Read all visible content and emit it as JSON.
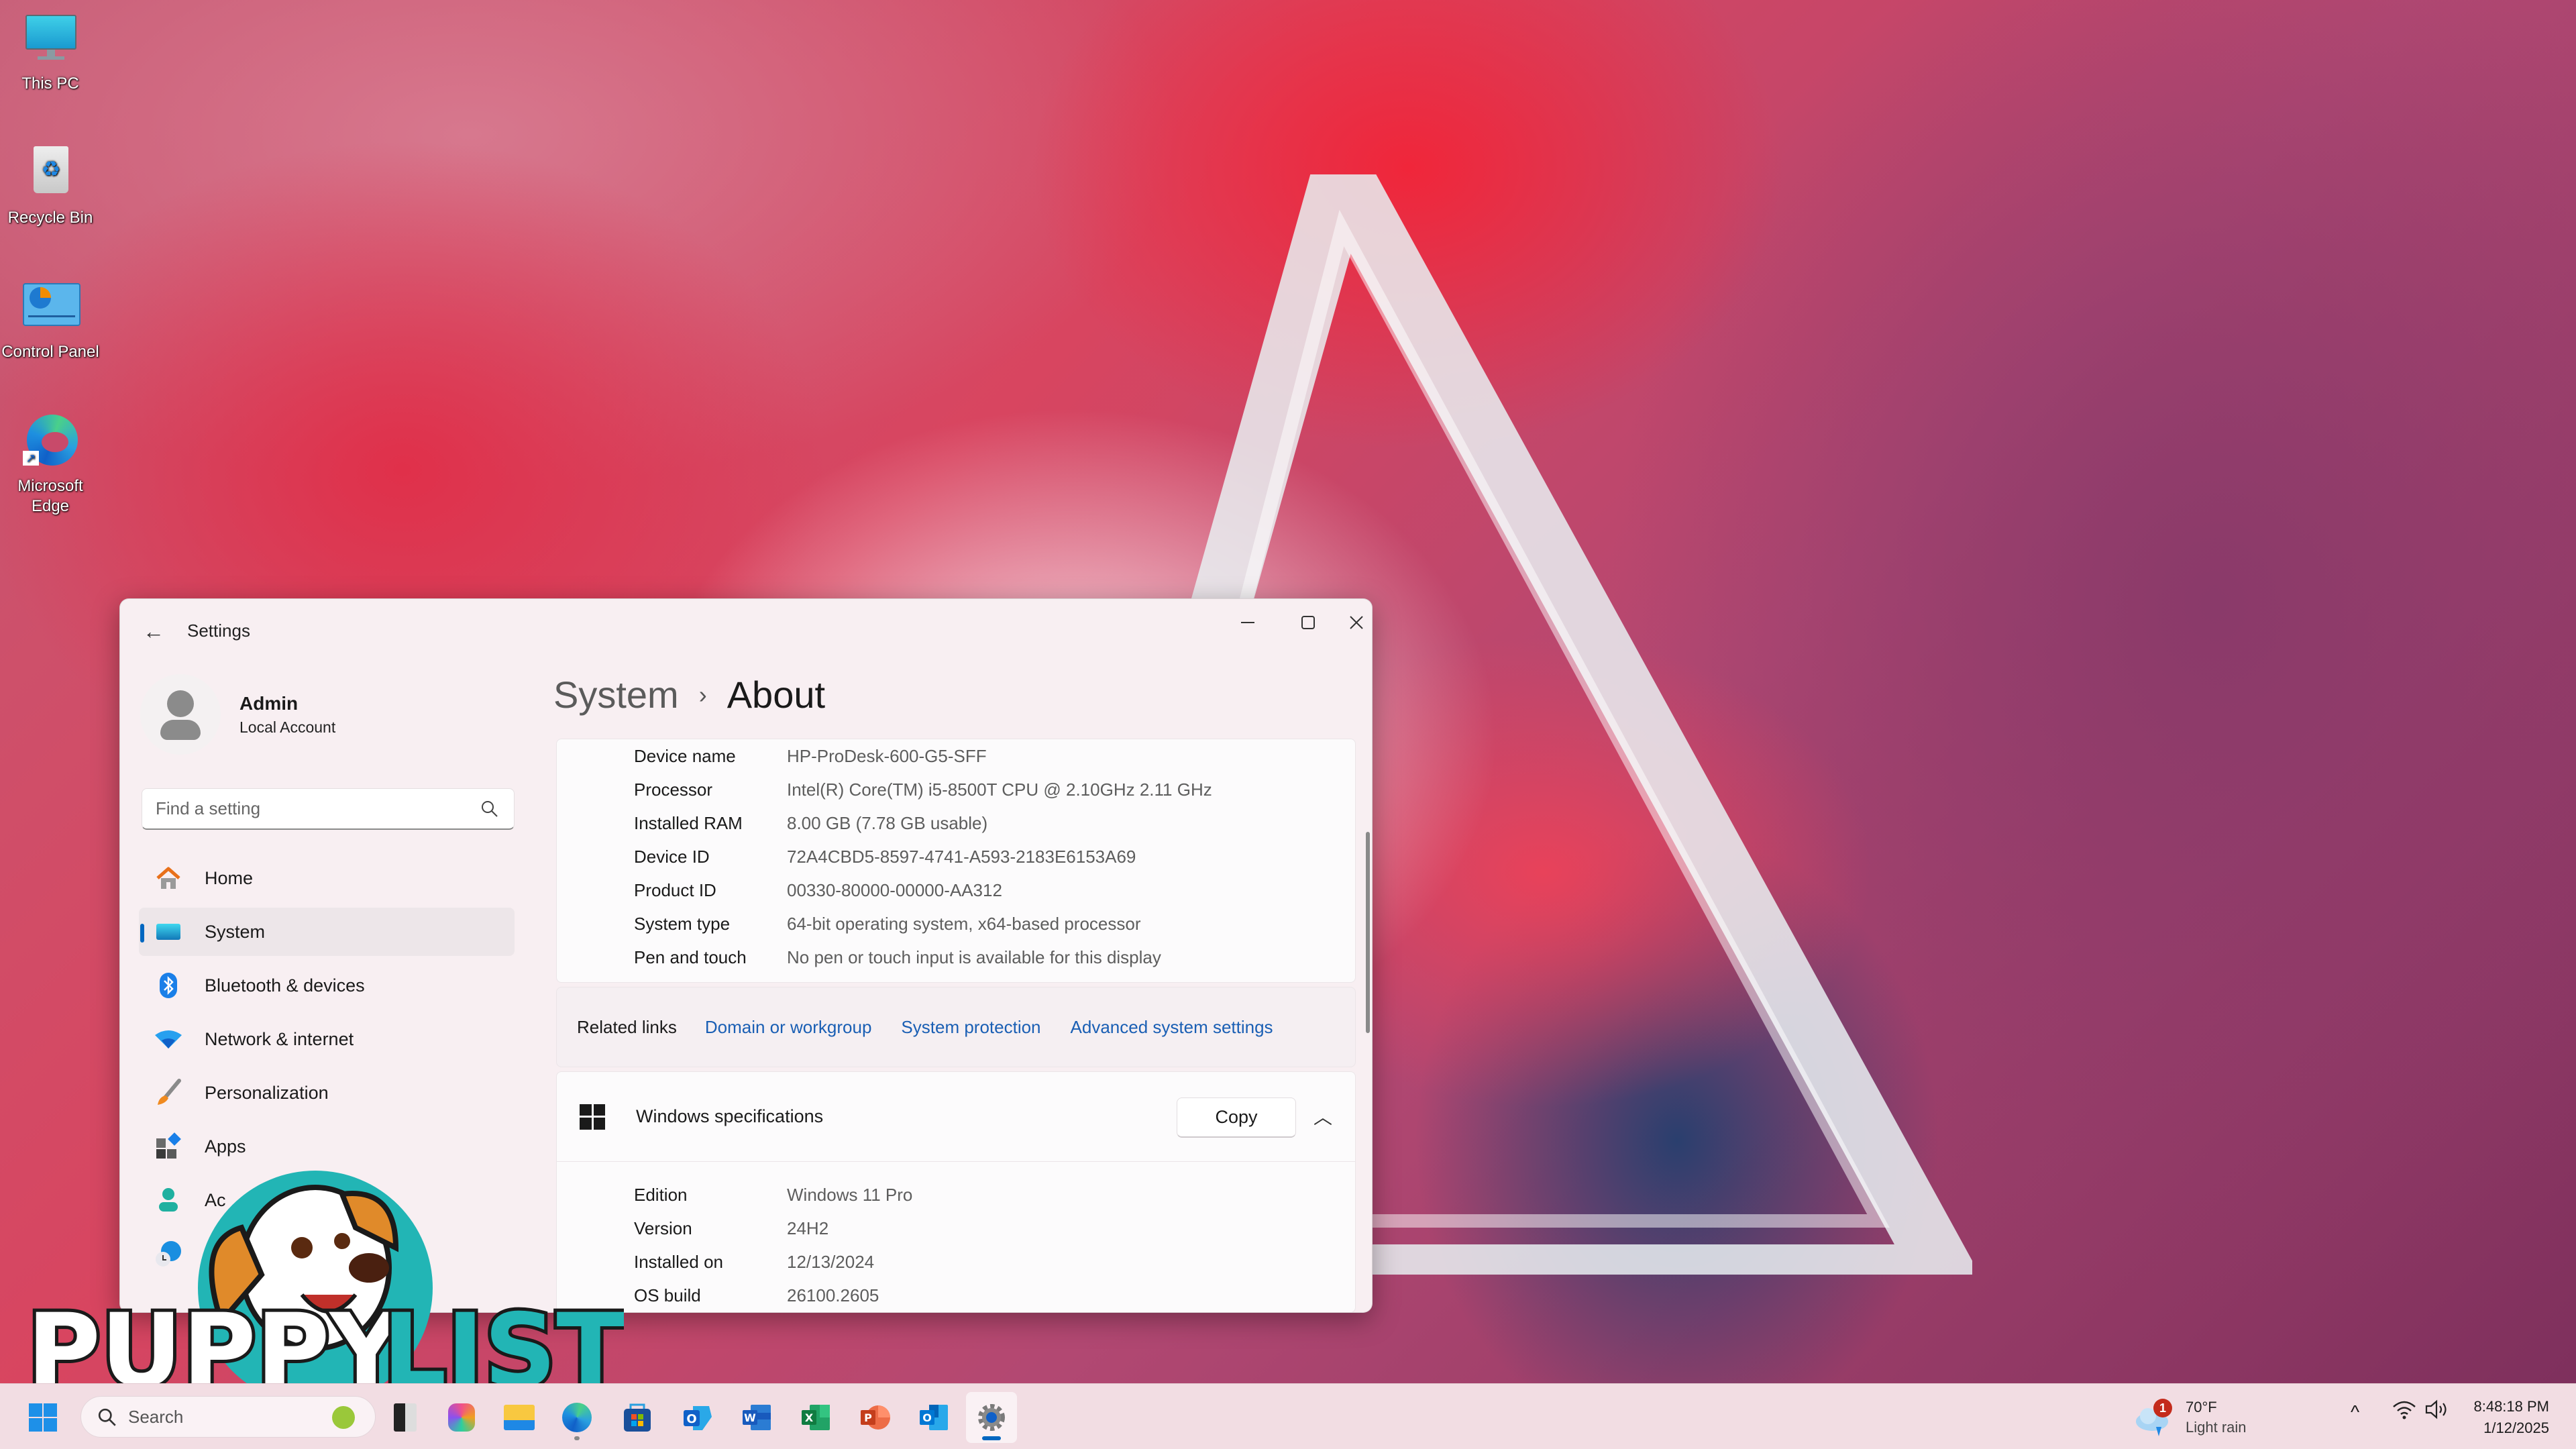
{
  "desktop": {
    "icons": [
      {
        "label": "This PC",
        "icon": "monitor-icon"
      },
      {
        "label": "Recycle Bin",
        "icon": "recycle-bin-icon"
      },
      {
        "label": "Control Panel",
        "icon": "control-panel-icon"
      },
      {
        "label": "Microsoft Edge",
        "icon": "edge-icon"
      }
    ]
  },
  "window": {
    "title": "Settings",
    "controls": {
      "minimize": "minimize-icon",
      "maximize": "maximize-icon",
      "close": "close-icon"
    }
  },
  "profile": {
    "name": "Admin",
    "account_type": "Local Account"
  },
  "search": {
    "placeholder": "Find a setting"
  },
  "nav": {
    "items": [
      {
        "label": "Home",
        "icon": "home-icon"
      },
      {
        "label": "System",
        "icon": "system-icon",
        "active": true
      },
      {
        "label": "Bluetooth & devices",
        "icon": "bluetooth-icon"
      },
      {
        "label": "Network & internet",
        "icon": "wifi-icon"
      },
      {
        "label": "Personalization",
        "icon": "brush-icon"
      },
      {
        "label": "Apps",
        "icon": "apps-icon"
      },
      {
        "label": "Ac",
        "icon": "accounts-icon"
      },
      {
        "label": "",
        "icon": "time-language-icon"
      }
    ]
  },
  "breadcrumb": {
    "parent": "System",
    "separator": "›",
    "current": "About"
  },
  "device_specs": [
    {
      "key": "Device name",
      "value": "HP-ProDesk-600-G5-SFF"
    },
    {
      "key": "Processor",
      "value": "Intel(R) Core(TM) i5-8500T CPU @ 2.10GHz   2.11 GHz"
    },
    {
      "key": "Installed RAM",
      "value": "8.00 GB (7.78 GB usable)"
    },
    {
      "key": "Device ID",
      "value": "72A4CBD5-8597-4741-A593-2183E6153A69"
    },
    {
      "key": "Product ID",
      "value": "00330-80000-00000-AA312"
    },
    {
      "key": "System type",
      "value": "64-bit operating system, x64-based processor"
    },
    {
      "key": "Pen and touch",
      "value": "No pen or touch input is available for this display"
    }
  ],
  "related_links": {
    "label": "Related links",
    "links": [
      "Domain or workgroup",
      "System protection",
      "Advanced system settings"
    ],
    "link_color": "#1a5fb4"
  },
  "windows_specs": {
    "title": "Windows specifications",
    "copy_label": "Copy",
    "rows": [
      {
        "key": "Edition",
        "value": "Windows 11 Pro"
      },
      {
        "key": "Version",
        "value": "24H2"
      },
      {
        "key": "Installed on",
        "value": "12/13/2024"
      },
      {
        "key": "OS build",
        "value": "26100.2605"
      }
    ]
  },
  "taskbar": {
    "search_placeholder": "Search",
    "apps": [
      "start-icon",
      "widgets-icon",
      "task-view-icon",
      "copilot-icon",
      "file-explorer-icon",
      "edge-icon",
      "store-icon",
      "outlook-new-icon",
      "word-icon",
      "excel-icon",
      "powerpoint-icon",
      "outlook-icon",
      "settings-icon"
    ],
    "weather": {
      "temp": "70°F",
      "condition": "Light rain",
      "badge": "1"
    },
    "time": "8:48:18 PM",
    "date": "1/12/2025"
  },
  "watermark": {
    "text_left": "PUPPY",
    "text_right": "LIST"
  },
  "colors": {
    "accent": "#0067c0",
    "window_bg": "#f8eff2",
    "taskbar_bg": "#f2dde3"
  }
}
